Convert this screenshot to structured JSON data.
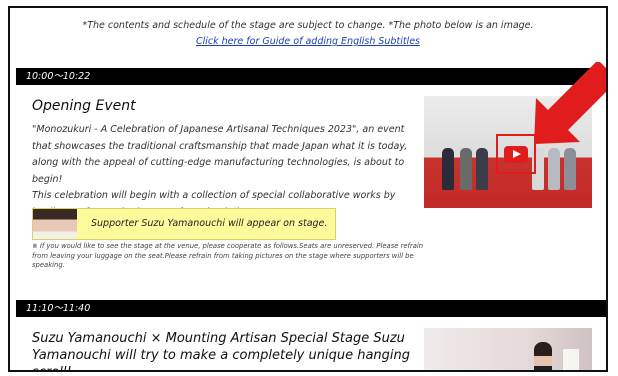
{
  "header": {
    "notice": "*The contents and schedule of the stage are subject to change. *The photo below is an image.",
    "subtitle_link": "Click here for Guide of adding English Subtitles"
  },
  "sessions": [
    {
      "time": "10:00〜10:22",
      "title": "Opening Event",
      "description": [
        "\"Monozukuri - A Celebration of Japanese Artisanal Techniques 2023\", an event that showcases the traditional craftsmanship that made Japan what it is today, along with the appeal of cutting-edge manufacturing technologies, is about to begin!",
        "This celebration will begin with a collection of special collaborative works by leading craftsmen in the manufacturing industry."
      ],
      "supporter_label": "Supporter Suzu Yamanouchi will appear on stage.",
      "note": "※ If you would like to see the stage at the venue, please cooperate as follows.Seats are unreserved. Please refrain from leaving your luggage on the seat.Please refrain from taking pictures on the stage where supporters will be speaking."
    },
    {
      "time": "11:10〜11:40",
      "title": "Suzu Yamanouchi × Mounting Artisan Special Stage Suzu Yamanouchi will try to make a completely unique hanging scroll!"
    }
  ],
  "colors": {
    "timebar": "#000000",
    "highlight": "#fdfb9b",
    "arrow": "#e01c1c",
    "link": "#1a3fb0"
  }
}
